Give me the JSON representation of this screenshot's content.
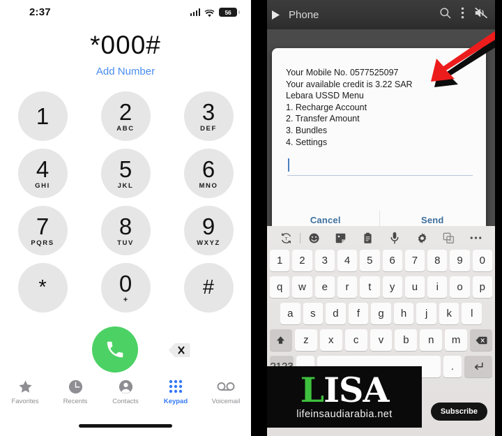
{
  "dialer": {
    "status": {
      "time": "2:37",
      "battery_level": "56",
      "signal": "cellular-bars",
      "wifi": "wifi-icon"
    },
    "dialed_number": "*000#",
    "add_number_label": "Add Number",
    "keys": [
      {
        "digit": "1",
        "letters": ""
      },
      {
        "digit": "2",
        "letters": "ABC"
      },
      {
        "digit": "3",
        "letters": "DEF"
      },
      {
        "digit": "4",
        "letters": "GHI"
      },
      {
        "digit": "5",
        "letters": "JKL"
      },
      {
        "digit": "6",
        "letters": "MNO"
      },
      {
        "digit": "7",
        "letters": "PQRS"
      },
      {
        "digit": "8",
        "letters": "TUV"
      },
      {
        "digit": "9",
        "letters": "WXYZ"
      },
      {
        "digit": "*",
        "letters": ""
      },
      {
        "digit": "0",
        "letters": "+"
      },
      {
        "digit": "#",
        "letters": ""
      }
    ],
    "call_button": "call-icon",
    "delete_button": "backspace-icon",
    "tabs": [
      {
        "label": "Favorites",
        "icon": "star-icon",
        "active": false
      },
      {
        "label": "Recents",
        "icon": "clock-icon",
        "active": false
      },
      {
        "label": "Contacts",
        "icon": "person-icon",
        "active": false
      },
      {
        "label": "Keypad",
        "icon": "keypad-icon",
        "active": true
      },
      {
        "label": "Voicemail",
        "icon": "voicemail-icon",
        "active": false
      }
    ],
    "accent_color": "#3478f6",
    "call_color": "#4cd164"
  },
  "video": {
    "topbar": {
      "play_icon": "play-icon",
      "title": "Phone",
      "search_icon": "search-icon",
      "menu_icon": "more-vertical-icon",
      "mute_icon": "speaker-muted-icon"
    },
    "ussd_dialog": {
      "lines": [
        "Your Mobile No. 0577525097",
        "Your available credit is 3.22 SAR",
        "Lebara USSD Menu",
        "1. Recharge Account",
        "2. Transfer Amount",
        "3. Bundles",
        "4. Settings"
      ],
      "input_value": "",
      "cancel_label": "Cancel",
      "send_label": "Send"
    },
    "annotation": {
      "shape": "red-arrow",
      "color": "#ed1c1c",
      "points_to": "Your Mobile No. 0577525097"
    },
    "keyboard": {
      "toolbar_icons": [
        "translate-icon",
        "emoji-icon",
        "sticker-icon",
        "clipboard-icon",
        "microphone-icon",
        "settings-gear-icon",
        "text-scan-icon",
        "more-horizontal-icon"
      ],
      "number_row": [
        "1",
        "2",
        "3",
        "4",
        "5",
        "6",
        "7",
        "8",
        "9",
        "0"
      ],
      "letter_row_1": [
        "q",
        "w",
        "e",
        "r",
        "t",
        "y",
        "u",
        "i",
        "o",
        "p"
      ],
      "letter_row_2": [
        "a",
        "s",
        "d",
        "f",
        "g",
        "h",
        "j",
        "k",
        "l"
      ],
      "letter_row_3": [
        "z",
        "x",
        "c",
        "v",
        "b",
        "n",
        "m"
      ],
      "backspace": "backspace-icon",
      "enter": "enter-icon"
    },
    "watermark": {
      "logo_first": "L",
      "logo_rest": "ISA",
      "url": "lifeinsaudiarabia.net",
      "green": "#3ec03e"
    },
    "subscribe_label": "Subscribe"
  }
}
